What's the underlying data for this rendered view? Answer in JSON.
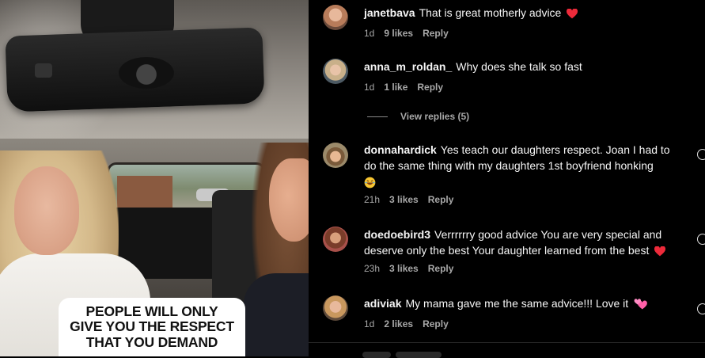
{
  "video": {
    "caption": "PEOPLE WILL ONLY\nGIVE YOU THE RESPECT\nTHAT YOU DEMAND"
  },
  "comments": [
    {
      "username": "janetbava",
      "text": "That is great motherly advice",
      "emoji": "red-heart",
      "time": "1d",
      "likes": "9 likes",
      "reply": "Reply"
    },
    {
      "username": "anna_m_roldan_",
      "text": "Why does she talk so fast",
      "time": "1d",
      "likes": "1 like",
      "reply": "Reply"
    },
    {
      "username": "donnahardick",
      "text": "Yes teach our daughters respect. Joan I had to do the same thing with my daughters 1st boyfriend honking",
      "emoji": "laughing-face",
      "time": "21h",
      "likes": "3 likes",
      "reply": "Reply"
    },
    {
      "username": "doedoebird3",
      "text": "Verrrrrry good advice You are very special and deserve only the best Your daughter learned from the best",
      "emoji": "red-heart",
      "time": "23h",
      "likes": "3 likes",
      "reply": "Reply"
    },
    {
      "username": "adiviak",
      "text": "My mama gave me the same advice!!! Love it",
      "emoji": "two-hearts",
      "time": "1d",
      "likes": "2 likes",
      "reply": "Reply"
    }
  ],
  "view_replies": "View replies (5)",
  "colors": {
    "background": "#000000",
    "text": "#f5f5f5",
    "muted": "#a8a8a8",
    "heart": "#ed2a3a",
    "pink_heart": "#ff5fa8"
  }
}
